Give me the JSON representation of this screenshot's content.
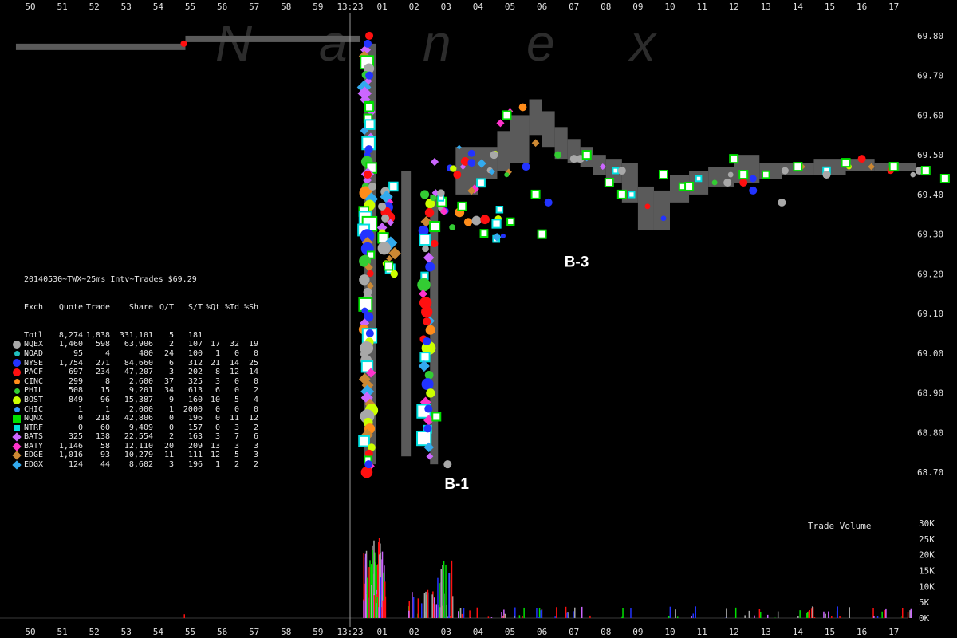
{
  "chart_data": {
    "type": "scatter",
    "watermark": "Nanex",
    "x_ticks_top": [
      "50",
      "51",
      "52",
      "53",
      "54",
      "55",
      "56",
      "57",
      "58",
      "59",
      "13:23",
      "01",
      "02",
      "03",
      "04",
      "05",
      "06",
      "07",
      "08",
      "09",
      "10",
      "11",
      "12",
      "13",
      "14",
      "15",
      "16",
      "17"
    ],
    "x_ticks_bottom": [
      "50",
      "51",
      "52",
      "53",
      "54",
      "55",
      "56",
      "57",
      "58",
      "59",
      "13:23",
      "01",
      "02",
      "03",
      "04",
      "05",
      "06",
      "07",
      "08",
      "09",
      "10",
      "11",
      "12",
      "13",
      "14",
      "15",
      "16",
      "17"
    ],
    "y_ticks": [
      "69.80",
      "69.70",
      "69.60",
      "69.50",
      "69.40",
      "69.30",
      "69.20",
      "69.10",
      "69.00",
      "68.90",
      "68.80",
      "68.70"
    ],
    "ylim": [
      68.65,
      69.83
    ],
    "volume_ticks": [
      "30K",
      "25K",
      "20K",
      "15K",
      "10K",
      "5K",
      "0K"
    ],
    "volume_label": "Trade Volume",
    "annotations": [
      {
        "text": "B-1",
        "x": 13.3,
        "y": 68.67
      },
      {
        "text": "B-3",
        "x": 17.05,
        "y": 69.23
      }
    ],
    "colors": {
      "NQEX": "#a8a8a8",
      "NQAD": "#20c0c0",
      "NYSE": "#2233ff",
      "PACF": "#ff1010",
      "CINC": "#ff8c1a",
      "PHIL": "#33cc33",
      "BOST": "#ccff00",
      "CHIC": "#3399ff",
      "NQNX": "#00e000",
      "NTRF": "#00e0e0",
      "BATS": "#cc66ff",
      "BATY": "#ff33cc",
      "EDGE": "#cc8833",
      "EDGX": "#33aaee",
      "nbbo": "#5a5a5a"
    },
    "series": [
      {
        "name": "NQEX",
        "x": [
          10.7,
          11.0,
          11.1,
          13.05,
          14.5,
          17.2,
          18.5,
          23.5,
          21.8,
          24.9,
          27.8
        ],
        "y": [
          69.42,
          69.37,
          69.34,
          68.72,
          69.5,
          69.49,
          69.46,
          69.38,
          69.43,
          69.45,
          69.46
        ]
      },
      {
        "name": "NYSE",
        "x": [
          10.55,
          10.6,
          10.62,
          10.58,
          12.4,
          12.45,
          12.43,
          13.8,
          15.5,
          16.2,
          22.6
        ],
        "y": [
          69.78,
          69.7,
          69.05,
          68.72,
          69.03,
          68.86,
          68.81,
          69.48,
          69.47,
          69.38,
          69.41
        ]
      },
      {
        "name": "PACF",
        "x": [
          10.6,
          10.55,
          12.4,
          13.35,
          22.3,
          26.0
        ],
        "y": [
          69.8,
          69.45,
          69.08,
          69.45,
          69.43,
          69.49
        ]
      },
      {
        "name": "NQNX",
        "x": [
          10.6,
          11.2,
          12.7,
          13.5,
          14.9,
          15.8,
          16.0,
          17.4,
          18.1,
          18.5,
          19.8,
          20.6,
          22.0,
          22.3,
          24.0,
          25.5,
          27.0,
          28.0,
          28.6
        ],
        "y": [
          69.62,
          69.22,
          68.84,
          69.37,
          69.6,
          69.4,
          69.3,
          69.5,
          69.43,
          69.4,
          69.45,
          69.42,
          69.49,
          69.45,
          69.47,
          69.48,
          69.47,
          69.46,
          69.44
        ]
      }
    ],
    "exchange_stats": {
      "header_title": "20140530~TWX~25ms Intv~Trades $69.29",
      "columns": [
        "Exch",
        "Quote",
        "Trade",
        "Share",
        "Q/T",
        "S/T",
        "%Qt",
        "%Td",
        "%Sh"
      ],
      "rows": [
        [
          "Totl",
          "8,274",
          "1,838",
          "331,101",
          "5",
          "181",
          "",
          "",
          ""
        ],
        [
          "NQEX",
          "1,460",
          "598",
          "63,906",
          "2",
          "107",
          "17",
          "32",
          "19"
        ],
        [
          "NQAD",
          "95",
          "4",
          "400",
          "24",
          "100",
          "1",
          "0",
          "0"
        ],
        [
          "NYSE",
          "1,754",
          "271",
          "84,660",
          "6",
          "312",
          "21",
          "14",
          "25"
        ],
        [
          "PACF",
          "697",
          "234",
          "47,207",
          "3",
          "202",
          "8",
          "12",
          "14"
        ],
        [
          "CINC",
          "299",
          "8",
          "2,600",
          "37",
          "325",
          "3",
          "0",
          "0"
        ],
        [
          "PHIL",
          "508",
          "15",
          "9,201",
          "34",
          "613",
          "6",
          "0",
          "2"
        ],
        [
          "BOST",
          "849",
          "96",
          "15,387",
          "9",
          "160",
          "10",
          "5",
          "4"
        ],
        [
          "CHIC",
          "1",
          "1",
          "2,000",
          "1",
          "2000",
          "0",
          "0",
          "0"
        ],
        [
          "NQNX",
          "0",
          "218",
          "42,806",
          "0",
          "196",
          "0",
          "11",
          "12"
        ],
        [
          "NTRF",
          "0",
          "60",
          "9,409",
          "0",
          "157",
          "0",
          "3",
          "2"
        ],
        [
          "BATS",
          "325",
          "138",
          "22,554",
          "2",
          "163",
          "3",
          "7",
          "6"
        ],
        [
          "BATY",
          "1,146",
          "58",
          "12,110",
          "20",
          "209",
          "13",
          "3",
          "3"
        ],
        [
          "EDGE",
          "1,016",
          "93",
          "10,279",
          "11",
          "111",
          "12",
          "5",
          "3"
        ],
        [
          "EDGX",
          "124",
          "44",
          "8,602",
          "3",
          "196",
          "1",
          "2",
          "2"
        ]
      ],
      "row_markers": [
        "none",
        "circle",
        "circle-small",
        "circle",
        "circle",
        "circle-small",
        "circle-small",
        "circle",
        "circle-small",
        "square",
        "square-small",
        "diamond",
        "diamond",
        "diamond",
        "diamond"
      ]
    }
  }
}
